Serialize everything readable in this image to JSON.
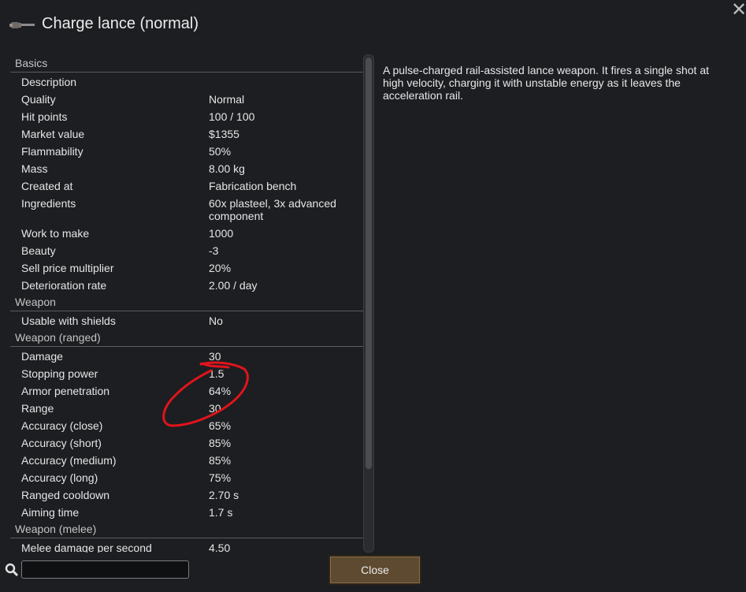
{
  "window": {
    "title": "Charge lance (normal)"
  },
  "description": "A pulse-charged rail-assisted lance weapon. It fires a single shot at high velocity, charging it with unstable energy as it leaves the acceleration rail.",
  "sections": [
    {
      "header": "Basics",
      "rows": [
        {
          "label": "Description",
          "value": ""
        },
        {
          "label": "Quality",
          "value": "Normal"
        },
        {
          "label": "Hit points",
          "value": "100 / 100"
        },
        {
          "label": "Market value",
          "value": "$1355"
        },
        {
          "label": "Flammability",
          "value": "50%"
        },
        {
          "label": "Mass",
          "value": "8.00 kg"
        },
        {
          "label": "Created at",
          "value": "Fabrication bench"
        },
        {
          "label": "Ingredients",
          "value": "60x plasteel, 3x advanced component"
        },
        {
          "label": "Work to make",
          "value": "1000"
        },
        {
          "label": "Beauty",
          "value": "-3"
        },
        {
          "label": "Sell price multiplier",
          "value": "20%"
        },
        {
          "label": "Deterioration rate",
          "value": "2.00 / day"
        }
      ]
    },
    {
      "header": "Weapon",
      "rows": [
        {
          "label": "Usable with shields",
          "value": "No"
        }
      ]
    },
    {
      "header": "Weapon (ranged)",
      "rows": [
        {
          "label": "Damage",
          "value": "30"
        },
        {
          "label": "Stopping power",
          "value": "1.5"
        },
        {
          "label": "Armor penetration",
          "value": "64%"
        },
        {
          "label": "Range",
          "value": "30"
        },
        {
          "label": "Accuracy (close)",
          "value": "65%"
        },
        {
          "label": "Accuracy (short)",
          "value": "85%"
        },
        {
          "label": "Accuracy (medium)",
          "value": "85%"
        },
        {
          "label": "Accuracy (long)",
          "value": "75%"
        },
        {
          "label": "Ranged cooldown",
          "value": "2.70 s"
        },
        {
          "label": "Aiming time",
          "value": "1.7 s"
        }
      ]
    },
    {
      "header": "Weapon (melee)",
      "rows": [
        {
          "label": "Melee damage per second",
          "value": "4.50"
        }
      ]
    }
  ],
  "search": {
    "value": ""
  },
  "buttons": {
    "close": "Close"
  },
  "colors": {
    "annotation": "#e0141c",
    "button_bg": "#5e4a30"
  },
  "icons": {
    "close": "close-icon",
    "search": "search-icon",
    "weapon": "charge-lance-icon"
  }
}
